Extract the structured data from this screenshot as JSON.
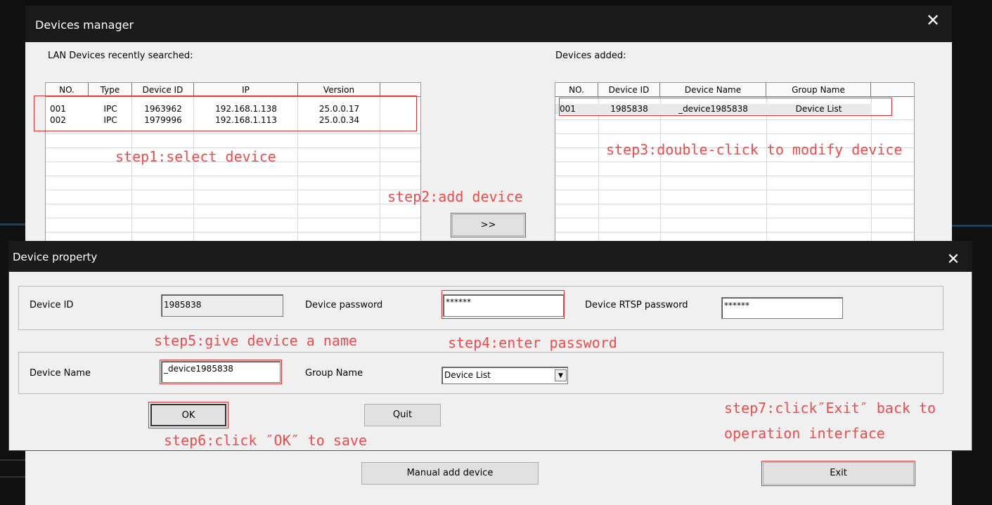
{
  "manager": {
    "title": "Devices manager",
    "close_glyph": "✕",
    "lan_label": "LAN Devices recently searched:",
    "added_label": "Devices added:",
    "lan_columns": [
      "NO.",
      "Type",
      "Device ID",
      "IP",
      "Version",
      ""
    ],
    "lan_rows": [
      [
        "001",
        "IPC",
        "1963962",
        "192.168.1.138",
        "25.0.0.17"
      ],
      [
        "002",
        "IPC",
        "1979996",
        "192.168.1.113",
        "25.0.0.34"
      ]
    ],
    "added_columns": [
      "NO.",
      "Device ID",
      "Device Name",
      "Group Name",
      ""
    ],
    "added_rows": [
      [
        "001",
        "1985838",
        "_device1985838",
        "Device List"
      ]
    ],
    "add_button": ">>",
    "manual_add_button": "Manual add device",
    "exit_button": "Exit"
  },
  "property": {
    "title": "Device property",
    "close_glyph": "✕",
    "device_id_label": "Device ID",
    "device_id_value": "1985838",
    "device_password_label": "Device password",
    "device_password_value": "******",
    "rtsp_password_label": "Device RTSP password",
    "rtsp_password_value": "******",
    "device_name_label": "Device Name",
    "device_name_value": "_device1985838",
    "group_name_label": "Group Name",
    "group_name_value": "Device List",
    "ok_button": "OK",
    "quit_button": "Quit"
  },
  "annotations": {
    "step1": "step1:select device",
    "step2": "step2:add device",
    "step3": "step3:double-click to modify device",
    "step4": "step4:enter password",
    "step5": "step5:give device a name",
    "step6": "step6:click ″OK″ to save",
    "step7_line1": "step7:click″Exit″ back to",
    "step7_line2": "operation interface"
  },
  "colors": {
    "annotation": "#f04a4a",
    "titlebar": "#1b1b1b",
    "window": "#f0f0f0"
  }
}
